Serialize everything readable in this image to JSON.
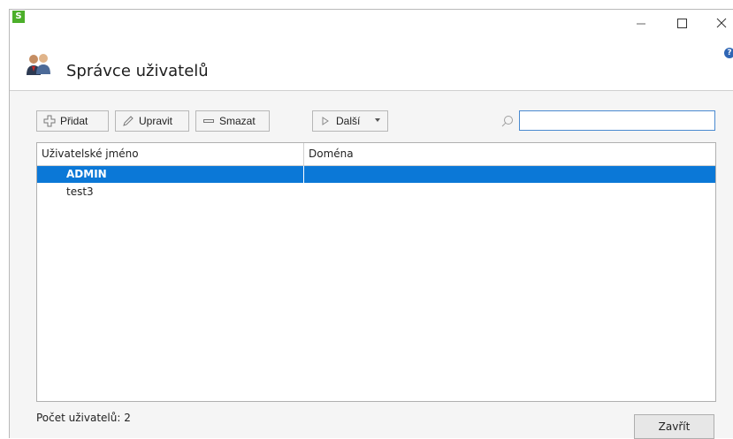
{
  "window": {
    "app_icon_letter": "S",
    "title": "Správce uživatelů",
    "help_glyph": "?"
  },
  "toolbar": {
    "add_label": "Přidat",
    "edit_label": "Upravit",
    "delete_label": "Smazat",
    "more_label": "Další",
    "search_value": ""
  },
  "table": {
    "columns": [
      "Uživatelské jméno",
      "Doména"
    ],
    "rows": [
      {
        "username": "ADMIN",
        "domain": "",
        "selected": true
      },
      {
        "username": "test3",
        "domain": "",
        "selected": false
      }
    ]
  },
  "footer": {
    "user_count": "Počet uživatelů: 2",
    "close_label": "Zavřít"
  },
  "colors": {
    "selection": "#0b78d7",
    "search_border": "#4a8ad0",
    "app_icon": "#4caf2a"
  },
  "icons": [
    "app-icon",
    "minimize-icon",
    "maximize-icon",
    "close-icon",
    "help-icon",
    "users-icon",
    "plus-icon",
    "pencil-icon",
    "minus-icon",
    "play-icon",
    "dropdown-arrow-icon",
    "search-icon"
  ]
}
